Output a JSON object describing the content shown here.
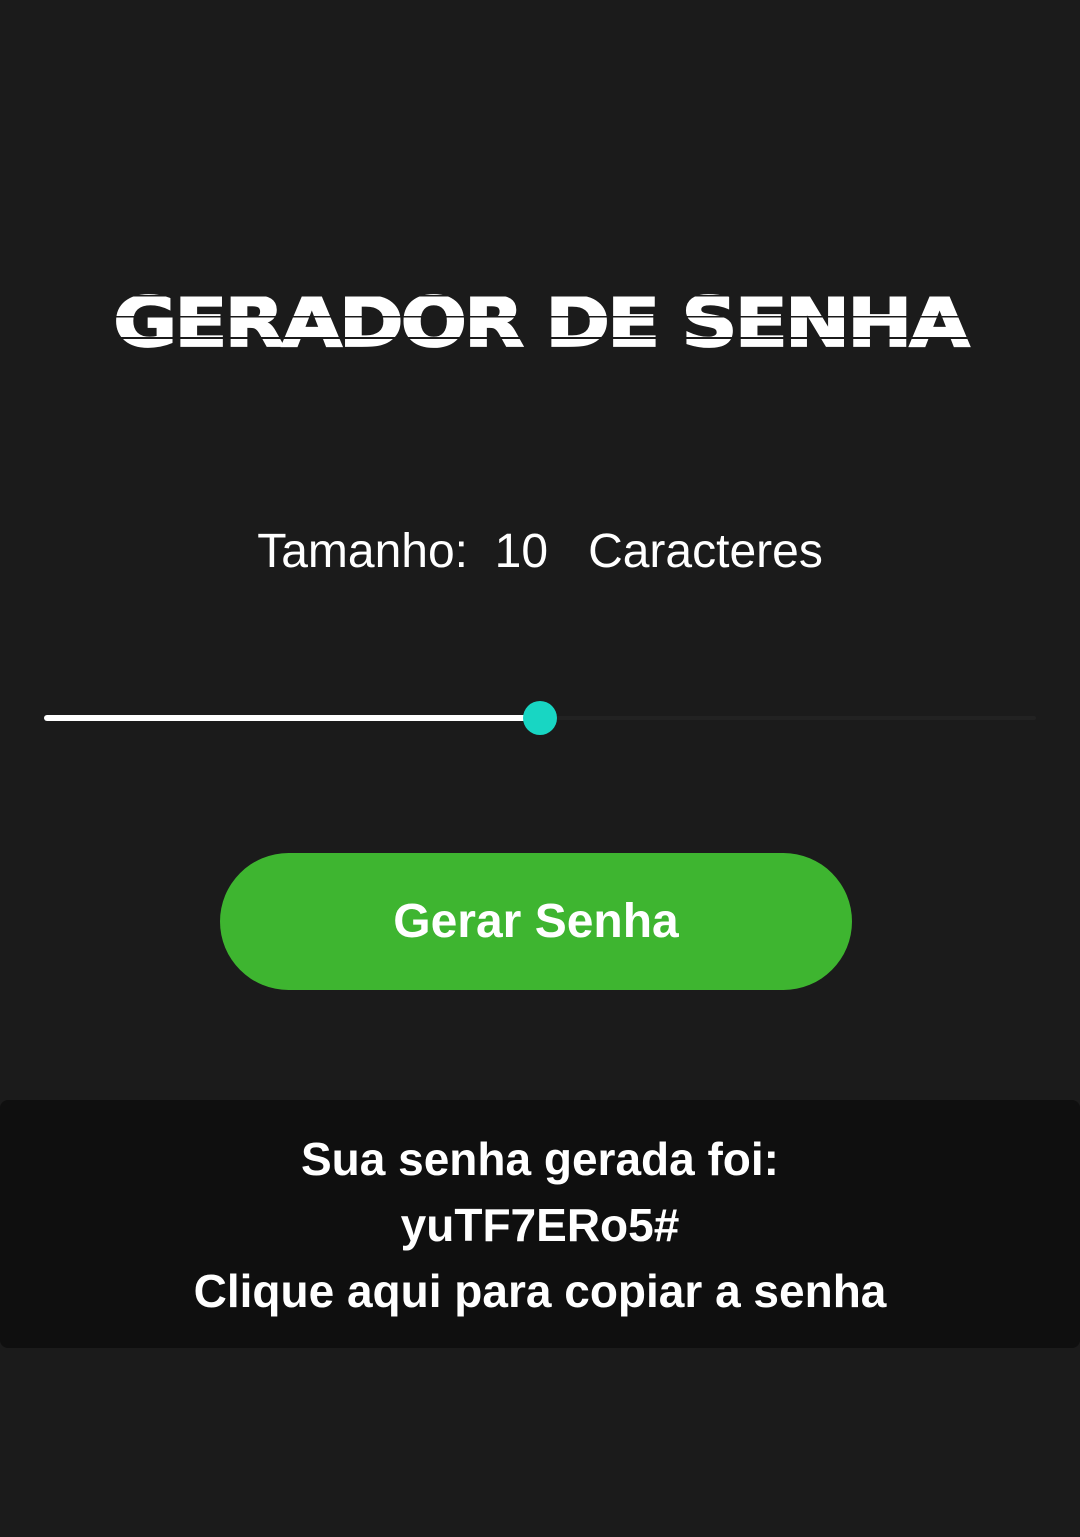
{
  "title": "GERADOR DE SENHA",
  "size": {
    "label": "Tamanho:",
    "value": "10",
    "unit": "Caracteres"
  },
  "slider": {
    "fraction": 0.5,
    "track_color": "#222222",
    "fill_color": "#ffffff",
    "thumb_color": "#18d6c3"
  },
  "button": {
    "label": "Gerar Senha",
    "color": "#3eb530"
  },
  "result": {
    "heading": "Sua senha gerada foi:",
    "password": "yuTF7ERo5#",
    "copy_hint": "Clique aqui para copiar a senha"
  },
  "colors": {
    "background": "#1b1b1b",
    "result_background": "#0f0f0f"
  }
}
